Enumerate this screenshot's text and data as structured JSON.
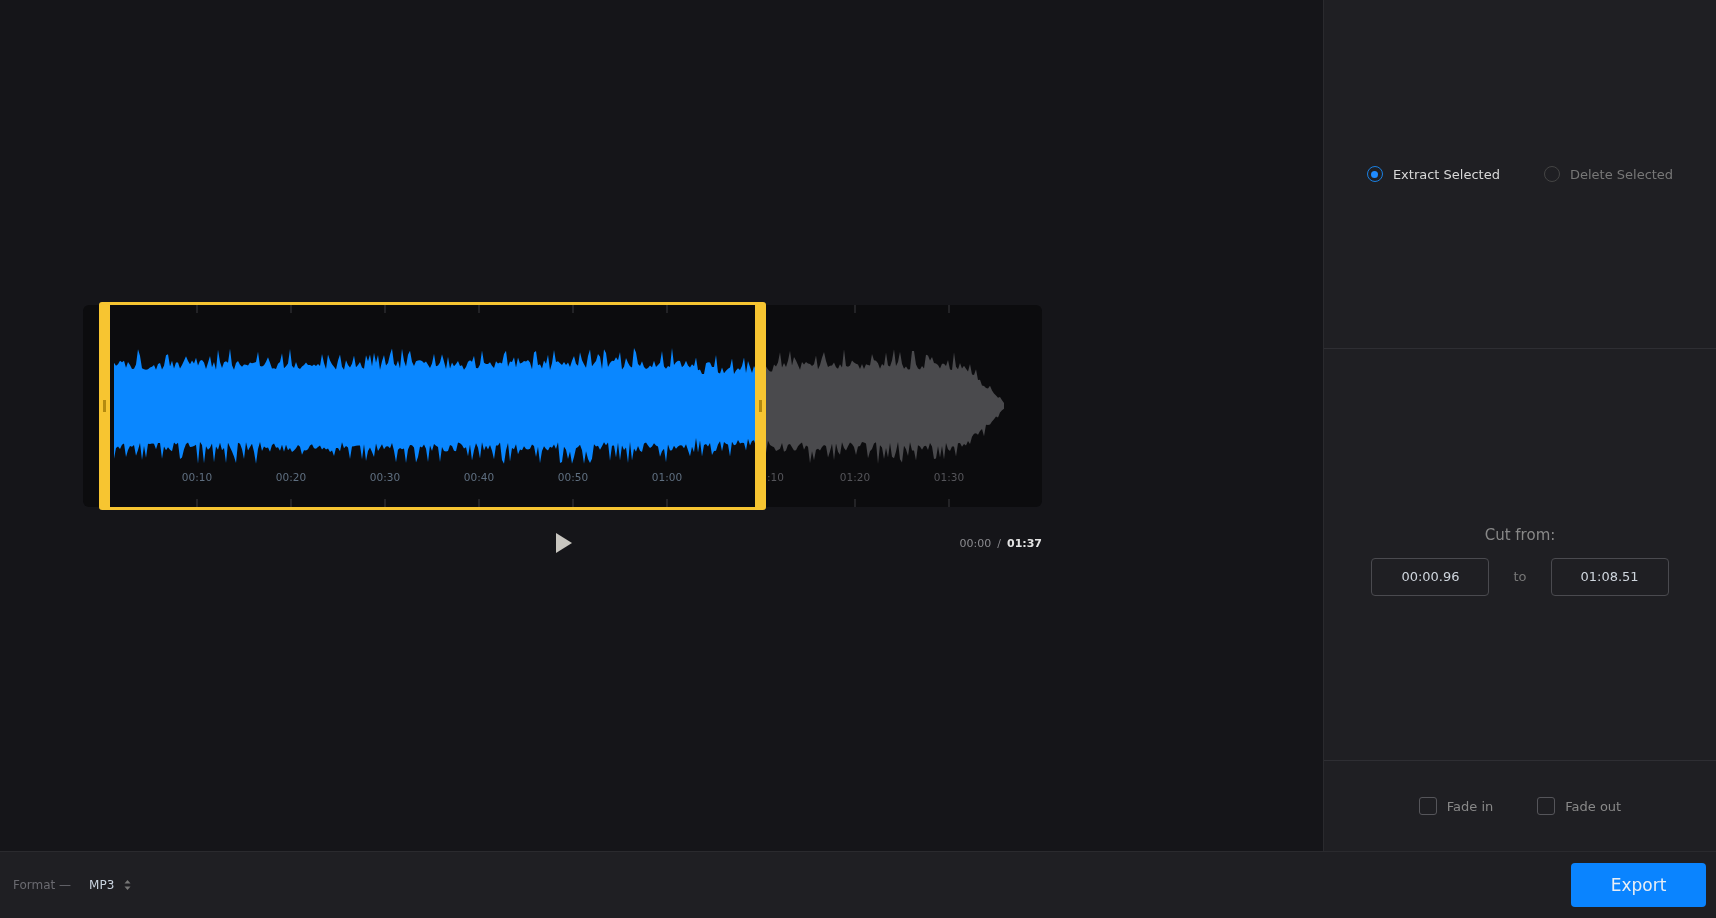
{
  "waveform": {
    "ticks": [
      "00:10",
      "00:20",
      "00:30",
      "00:40",
      "00:50",
      "01:00",
      ":10",
      "01:20",
      "01:30"
    ],
    "selection": {
      "start": {
        "level": 0.022
      },
      "end": {
        "level": 0.706
      }
    }
  },
  "player": {
    "current_time": "00:00",
    "separator": "/",
    "duration": "01:37"
  },
  "modes": [
    {
      "label": "Extract Selected",
      "selected": true
    },
    {
      "label": "Delete Selected",
      "selected": false
    }
  ],
  "cut": {
    "label": "Cut from:",
    "from": "00:00.96",
    "joiner": "to",
    "to": "01:08.51"
  },
  "fades": [
    {
      "label": "Fade in",
      "checked": false
    },
    {
      "label": "Fade out",
      "checked": false
    }
  ],
  "format": {
    "label": "Format —",
    "value": "MP3"
  },
  "export_button": "Export"
}
